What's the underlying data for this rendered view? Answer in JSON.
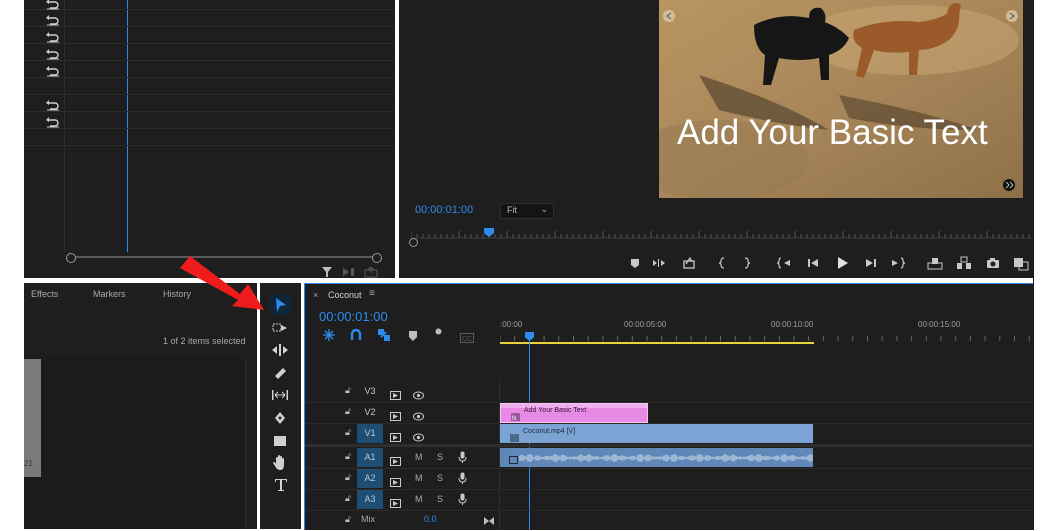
{
  "source_monitor": {
    "undo_rows": 7
  },
  "program_monitor": {
    "timecode": "00:00:01:00",
    "fit_label": "Fit",
    "overlay_text": "Add Your Basic Text"
  },
  "project_panel": {
    "tabs": [
      "Effects",
      "Markers",
      "History"
    ],
    "selection_info": "1 of 2 items selected",
    "side_number": "21"
  },
  "sequence": {
    "name": "Coconut",
    "timecode": "00:00:01:00",
    "ruler_ticks": [
      ":00:00",
      "00:00:05:00",
      "00:00:10:00",
      "00:00:15:00"
    ],
    "video_tracks": [
      {
        "name": "V3",
        "active": false
      },
      {
        "name": "V2",
        "active": false
      },
      {
        "name": "V1",
        "active": true
      }
    ],
    "audio_tracks": [
      {
        "name": "A1",
        "active": true
      },
      {
        "name": "A2",
        "active": true
      },
      {
        "name": "A3",
        "active": true
      }
    ],
    "mute_label": "M",
    "solo_label": "S",
    "mix_label": "Mix",
    "mix_value": "0.0",
    "clips": {
      "title_clip": "Add Your Basic Text",
      "video_clip": "Coconut.mp4 [V]"
    }
  },
  "colors": {
    "accent_blue": "#2d8ceb",
    "title_clip": "#e68ae6",
    "video_clip": "#7ba3d3",
    "audio_clip": "#5f87b8",
    "work_area": "#e8d33a",
    "arrow": "#ee1c1c"
  }
}
